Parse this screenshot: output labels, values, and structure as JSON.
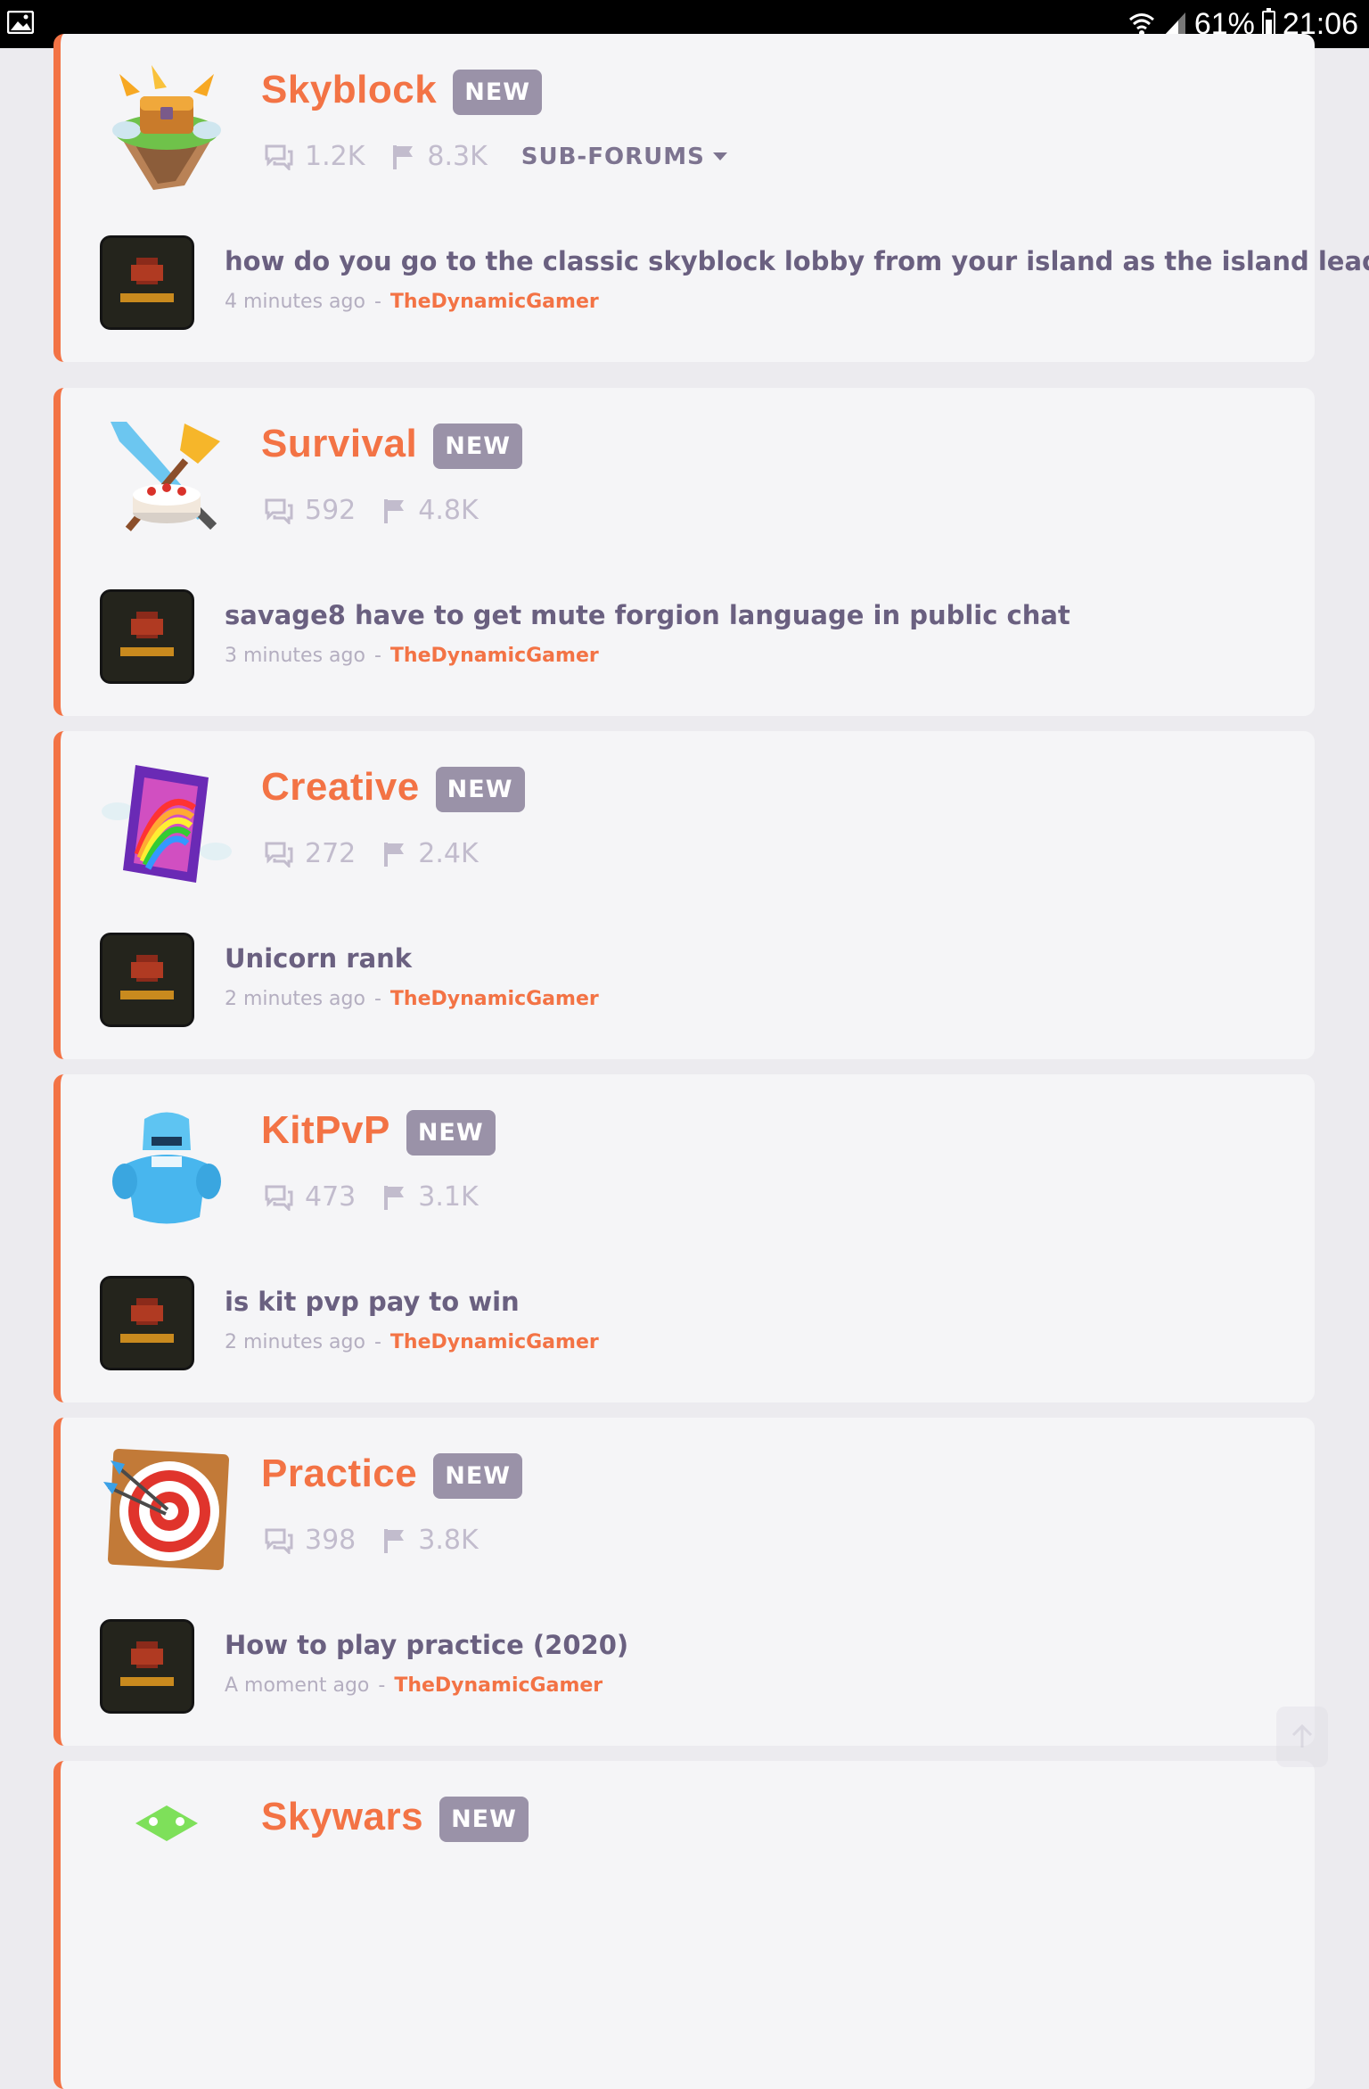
{
  "status_bar": {
    "battery": "61%",
    "time": "21:06"
  },
  "forums": [
    {
      "title": "Skyblock",
      "badge": "NEW",
      "threads": "1.2K",
      "posts": "8.3K",
      "subforums_label": "SUB-FORUMS",
      "latest_post": {
        "title": "how do you go to the classic skyblock lobby from your island as the island leader",
        "time": "4 minutes ago",
        "author": "TheDynamicGamer"
      }
    },
    {
      "title": "Survival",
      "badge": "NEW",
      "threads": "592",
      "posts": "4.8K",
      "latest_post": {
        "title": "savage8 have to get mute forgion language in public chat",
        "time": "3 minutes ago",
        "author": "TheDynamicGamer"
      }
    },
    {
      "title": "Creative",
      "badge": "NEW",
      "threads": "272",
      "posts": "2.4K",
      "latest_post": {
        "title": "Unicorn rank",
        "time": "2 minutes ago",
        "author": "TheDynamicGamer"
      }
    },
    {
      "title": "KitPvP",
      "badge": "NEW",
      "threads": "473",
      "posts": "3.1K",
      "latest_post": {
        "title": "is kit pvp pay to win",
        "time": "2 minutes ago",
        "author": "TheDynamicGamer"
      }
    },
    {
      "title": "Practice",
      "badge": "NEW",
      "threads": "398",
      "posts": "3.8K",
      "latest_post": {
        "title": "How to play practice (2020)",
        "time": "A moment ago",
        "author": "TheDynamicGamer"
      }
    },
    {
      "title": "Skywars",
      "badge": "NEW"
    }
  ],
  "meta_separator": "-",
  "colors": {
    "accent": "#f37345",
    "badge": "#9a92a8",
    "card": "#f5f5f7",
    "page": "#ecebef",
    "post_title": "#6a6080",
    "muted": "#c2bccd"
  },
  "icons": [
    "gallery-icon",
    "wifi-icon",
    "signal-icon",
    "battery-icon",
    "threads-icon",
    "flag-icon",
    "caret-down-icon",
    "scroll-top-icon"
  ]
}
